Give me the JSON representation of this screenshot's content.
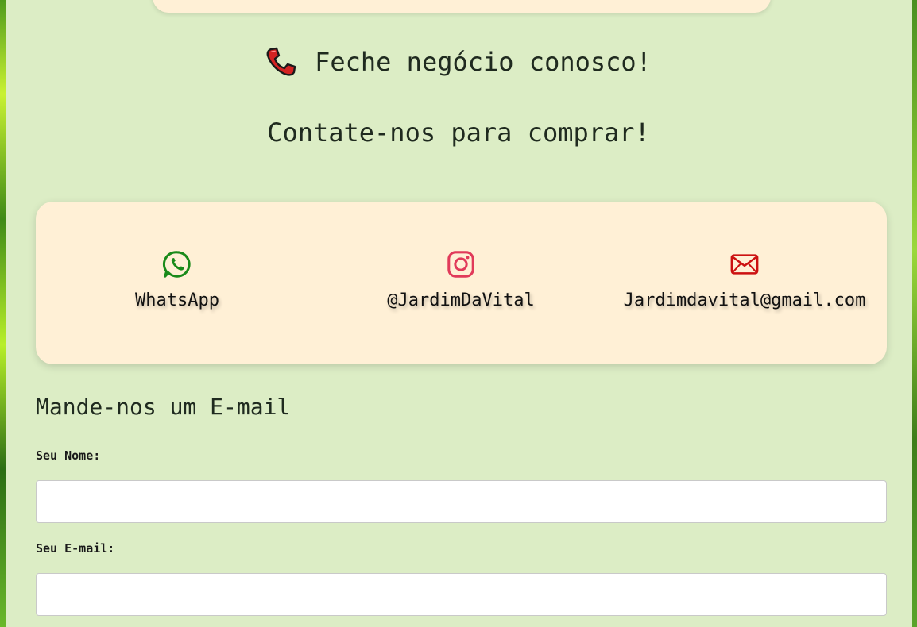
{
  "header": {
    "title": "Feche negócio conosco!",
    "subtitle": "Contate-nos para comprar!"
  },
  "contacts": [
    {
      "icon": "whatsapp-icon",
      "label": "WhatsApp",
      "color": "#1a8a1a"
    },
    {
      "icon": "instagram-icon",
      "label": "@JardimDaVital",
      "color": "#e1306c"
    },
    {
      "icon": "email-icon",
      "label": "Jardimdavital@gmail.com",
      "color": "#cc1111"
    }
  ],
  "form": {
    "heading": "Mande-nos um E-mail",
    "name_label": "Seu Nome:",
    "name_value": "",
    "email_label": "Seu E-mail:",
    "email_value": ""
  },
  "colors": {
    "panel": "#dcedc5",
    "card": "#fff0d6"
  }
}
